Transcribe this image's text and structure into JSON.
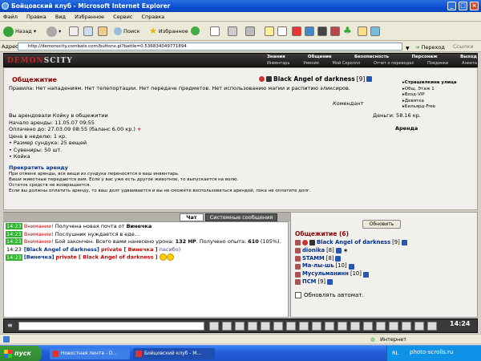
{
  "window": {
    "title": "Бойцовский клуб - Microsoft Internet Explorer"
  },
  "menu": [
    "Файл",
    "Правка",
    "Вид",
    "Избранное",
    "Сервис",
    "Справка"
  ],
  "toolbar": {
    "back": "Назад",
    "search": "Поиск",
    "favorites": "Избранное"
  },
  "address": {
    "label": "Адрес:",
    "url": "http://demonscity.combats.com/buttons.pl?battle=0.536834049771894",
    "go": "Переход",
    "links": "Ссылки"
  },
  "site": {
    "logo_a": "DEMON",
    "logo_b": "SCITY",
    "nav_top": [
      "Знания",
      "Общение",
      "Безопасность",
      "Персонаж",
      "Выход"
    ],
    "nav_bottom": [
      "Инвентарь",
      "Умения",
      "Мой Скроллл",
      "Отчет о переводах",
      "Поединки",
      "Анкета"
    ]
  },
  "page": {
    "title": "Общежитие",
    "player_name": "Black Angel of darkness",
    "player_level": "[9]",
    "rules": "Правила: Нет нападениям. Нет телепортации. Нет передаче предметов. Нет использованию магии и распитию эликсиров.",
    "komendant": "Комендант",
    "locations": [
      "Страшилкина улица",
      "Общ. Этаж 1",
      "Вход-VIP",
      "Девятка",
      "Бильярд-Free"
    ],
    "rent": {
      "line1": "Вы арендовали Койку в общежитии",
      "line2": "Начало аренды: 11.05.07 09:55",
      "line3": "Оплачено до: 27.03.09 08:55 (баланс 6.00 кр.)",
      "line4": "Цена в неделю: 1 кр.",
      "items": [
        "Размер сундука: 25 вещей",
        "Сувениры: 50 шт.",
        "Койка"
      ]
    },
    "money": "Деньги: 58.16 кр.",
    "arenda": "Аренда",
    "cancel_link": "Прекратить аренду",
    "notes": [
      "При отмене аренды, все вещи из сундука переносятся в ваш инвентарь.",
      "Ваши животные передаются вам. Если у вас уже есть другое животное, то выпускается на волю.",
      "Остаток средств не возвращается.",
      "Если вы должны оплатить аренду, то ваш долг удваивается и вы не сможете воспользоваться арендой, пока не оплатите долг."
    ]
  },
  "chat": {
    "tab_chat": "Чат",
    "tab_system": "Системные сообщения",
    "lines": [
      {
        "time": "14:23",
        "warn": "Внимание!",
        "text": "Получена новая почта от",
        "who": "Винечка"
      },
      {
        "time": "14:23",
        "warn": "Внимание!",
        "text": "Послушник нуждается в еде..."
      },
      {
        "time": "14:23",
        "warn": "Внимание!",
        "text": "Бой закончен. Всего вами нанесено урона:",
        "hp": "132 HP",
        "rest": ". Получено опыта:",
        "exp": "610",
        "pct": "(105%)."
      },
      {
        "time": "14:23",
        "from": "[Black Angel of darkness]",
        "priv": "private [ Винечка ]",
        "msg": "пасибо)"
      },
      {
        "time": "14:23",
        "from": "[Винечка]",
        "priv": "private [ Black Angel of darkness ]"
      }
    ]
  },
  "online": {
    "refresh": "Обновить",
    "title": "Общежитие (6)",
    "players": [
      {
        "name": "Black Angel of darkness",
        "lvl": "[9]"
      },
      {
        "name": "dionika",
        "lvl": "[8]"
      },
      {
        "name": "STAMM",
        "lvl": "[8]"
      },
      {
        "name": "Ма-лы-шь",
        "lvl": "[10]"
      },
      {
        "name": "Мусульманинн",
        "lvl": "[10]"
      },
      {
        "name": "ПСМ",
        "lvl": "[9]"
      }
    ],
    "auto": "Обновлять автомат."
  },
  "clock": "14:24",
  "status": {
    "zone": "Интернет"
  },
  "taskbar": {
    "start": "пуск",
    "tasks": [
      "Новостная лента - D...",
      "Бойцовский клуб - M..."
    ],
    "lang": "RL",
    "watermark": "photo-scrolls.ru"
  }
}
